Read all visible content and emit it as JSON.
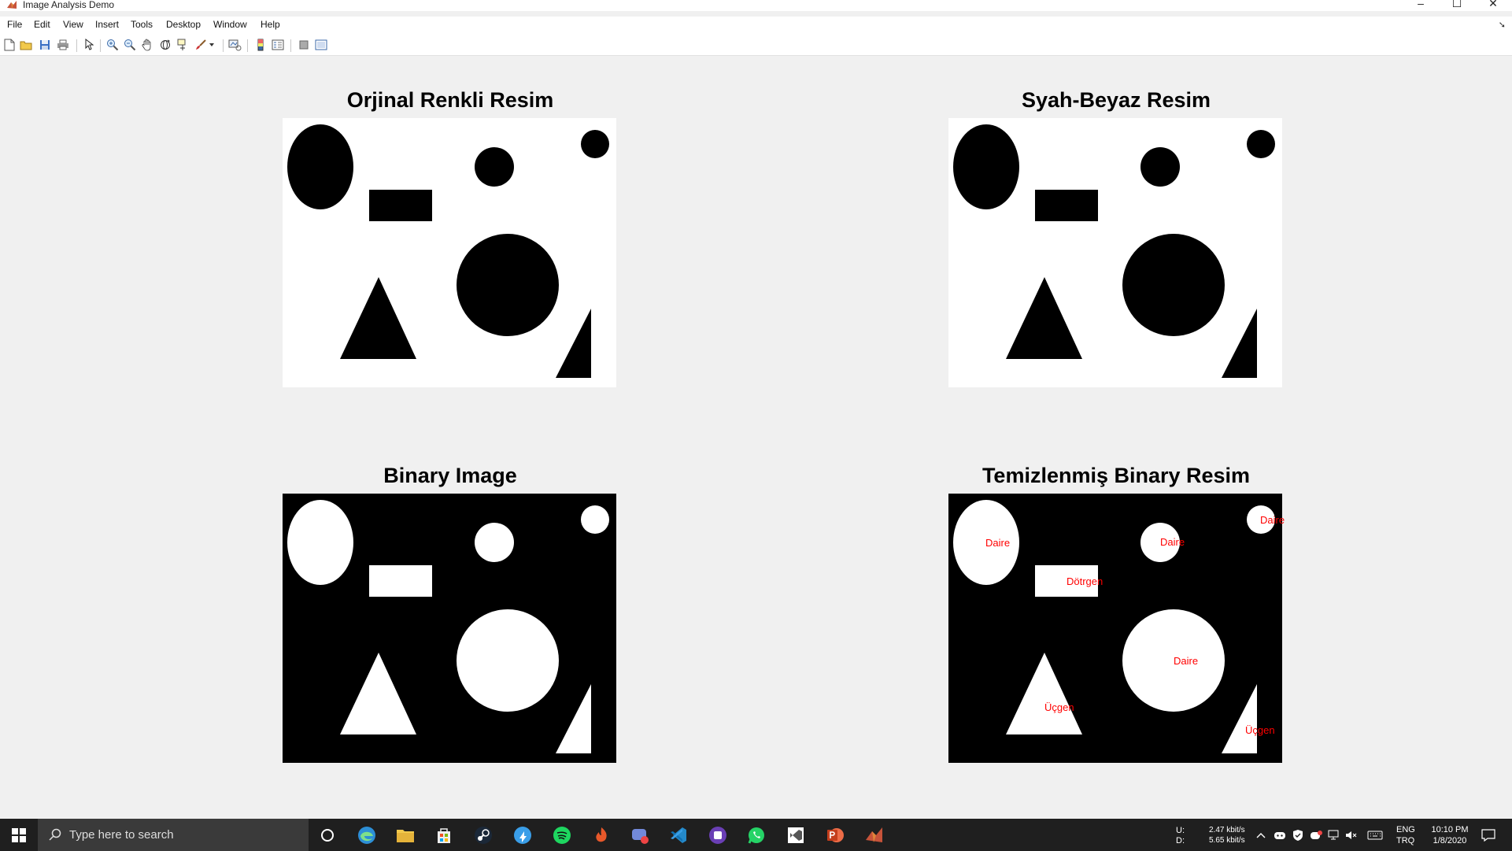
{
  "window": {
    "title": "Image Analysis Demo",
    "controls": [
      "–",
      "☐",
      "✕"
    ]
  },
  "menu": [
    "File",
    "Edit",
    "View",
    "Insert",
    "Tools",
    "Desktop",
    "Window",
    "Help"
  ],
  "toolbar_icons": [
    "new-figure-icon",
    "open-file-icon",
    "save-icon",
    "print-icon",
    "pointer-icon",
    "zoom-in-icon",
    "zoom-out-icon",
    "pan-icon",
    "rotate-3d-icon",
    "data-cursor-icon",
    "brush-icon",
    "brush-dropdown-icon",
    "link-plot-icon",
    "colorbar-icon",
    "legend-icon",
    "hide-plot-tools-icon",
    "show-plot-tools-icon"
  ],
  "panels": [
    {
      "title": "Orjinal Renkli Resim",
      "bg": "#ffffff",
      "fg": "#000000"
    },
    {
      "title": "Syah-Beyaz Resim",
      "bg": "#ffffff",
      "fg": "#000000"
    },
    {
      "title": "Binary Image",
      "bg": "#000000",
      "fg": "#ffffff"
    },
    {
      "title": "Temizlenmiş Binary Resim",
      "bg": "#000000",
      "fg": "#ffffff"
    }
  ],
  "shape_labels": [
    "Daire",
    "Daire",
    "Daire",
    "Dötrgen",
    "Daire",
    "Üçgen",
    "Üçgen"
  ],
  "taskbar": {
    "search_placeholder": "Type here to search",
    "net_labels": [
      "U:",
      "D:"
    ],
    "net_up": "2.47 kbit/s",
    "net_down": "5.65 kbit/s",
    "lang": "ENG",
    "locale": "TRQ",
    "time": "10:10 PM",
    "date": "1/8/2020"
  }
}
